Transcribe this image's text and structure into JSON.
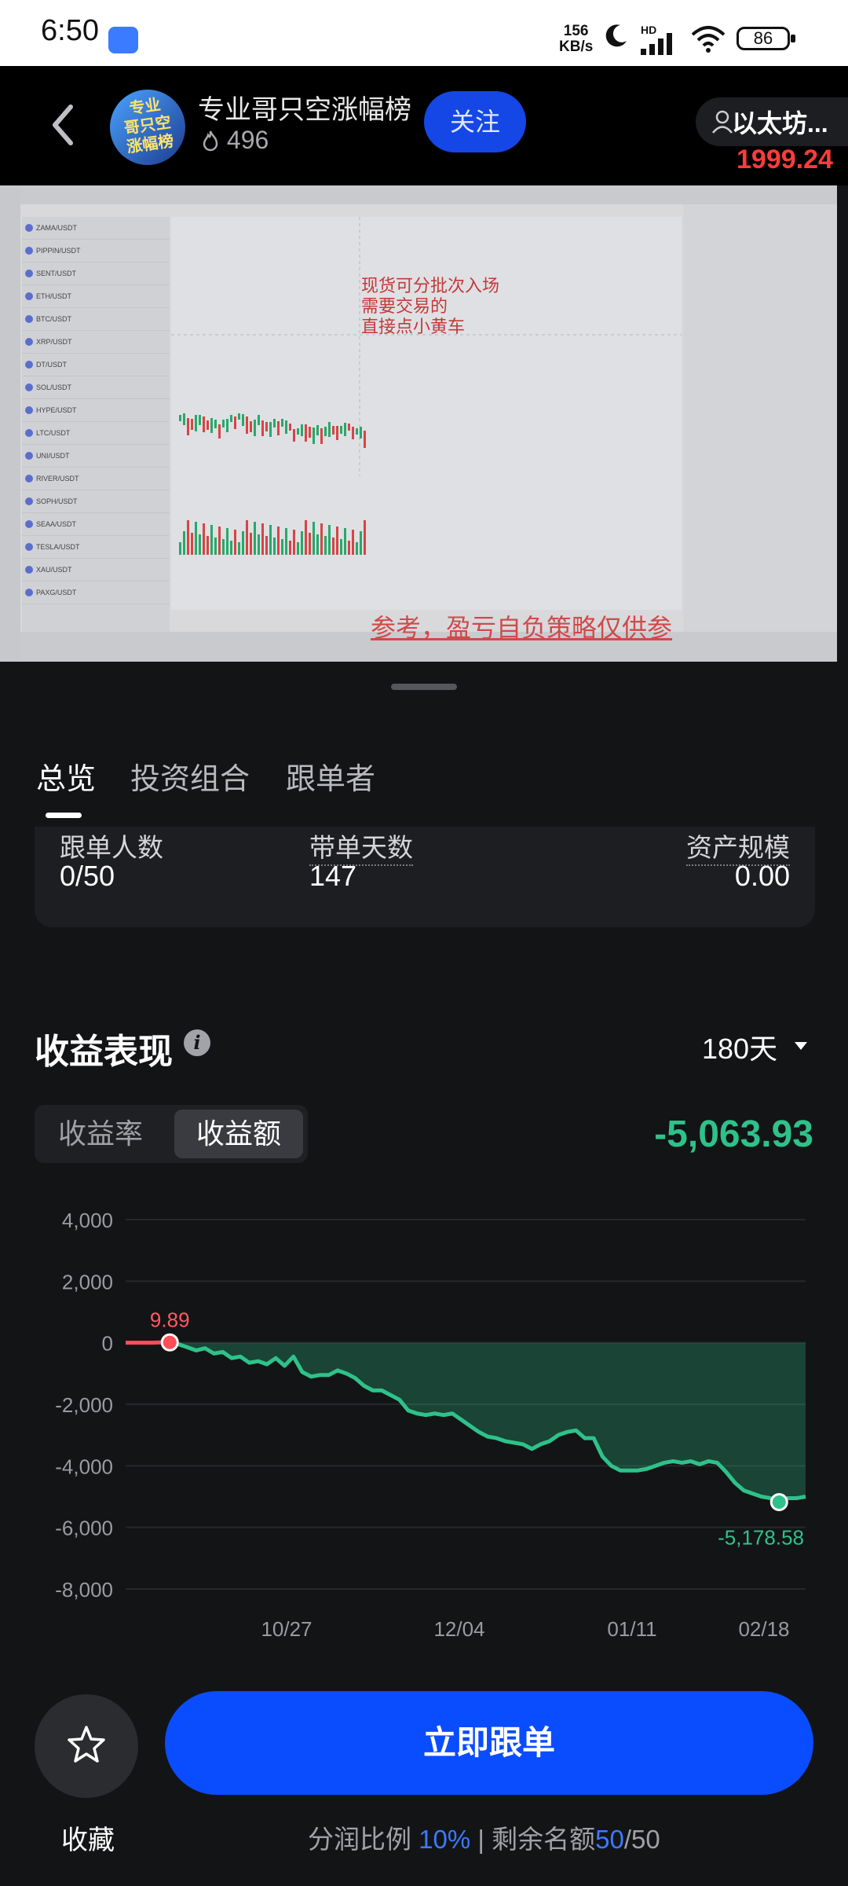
{
  "status_bar": {
    "time": "6:50",
    "net_speed_value": "156",
    "net_speed_unit": "KB/s",
    "network": "HD",
    "battery": "86"
  },
  "header": {
    "avatar_text": "专业\n哥只空\n涨幅榜",
    "trader_name": "专业哥只空涨幅榜",
    "hot_count": "496",
    "follow_label": "关注",
    "coin_name": "以太坊...",
    "coin_price": "1999.24"
  },
  "video": {
    "note": "现货可分批次入场\n需要交易的\n直接点小黄车",
    "watermark": "参考，盈亏自负策略仅供参",
    "rows": [
      "ZAMA/USDT",
      "PIPPIN/USDT",
      "SENT/USDT",
      "ETH/USDT",
      "BTC/USDT",
      "XRP/USDT",
      "DT/USDT",
      "SOL/USDT",
      "HYPE/USDT",
      "LTC/USDT",
      "UNI/USDT",
      "RIVER/USDT",
      "SOPH/USDT",
      "SEAA/USDT",
      "TESLA/USDT",
      "XAU/USDT",
      "PAXG/USDT"
    ]
  },
  "tabs": {
    "overview": "总览",
    "portfolio": "投资组合",
    "followers": "跟单者"
  },
  "stats": [
    {
      "label": "跟单人数",
      "value": "0/50"
    },
    {
      "label": "带单天数",
      "value": "147"
    },
    {
      "label": "资产规模",
      "value": "0.00"
    }
  ],
  "performance": {
    "title": "收益表现",
    "info_icon": "i",
    "period": "180天",
    "seg_rate": "收益率",
    "seg_amount": "收益额",
    "total": "-5,063.93"
  },
  "colors": {
    "up_green": "#2ec28a",
    "down_red": "#ff3b3b",
    "accent_blue": "#0a4cff"
  },
  "chart_data": {
    "type": "area",
    "x_ticks": [
      "10/27",
      "12/04",
      "01/11",
      "02/18"
    ],
    "y_ticks": [
      "4,000",
      "2,000",
      "0",
      "-2,000",
      "-4,000",
      "-6,000",
      "-8,000"
    ],
    "ylim": [
      -8000,
      4000
    ],
    "annotations": {
      "high": "9.89",
      "low": "-5,178.58"
    },
    "values": [
      0,
      0,
      0,
      0,
      10,
      9.89,
      -50,
      -150,
      -250,
      -180,
      -350,
      -300,
      -500,
      -450,
      -650,
      -600,
      -700,
      -500,
      -750,
      -450,
      -950,
      -1100,
      -1050,
      -1050,
      -900,
      -1000,
      -1150,
      -1400,
      -1550,
      -1550,
      -1700,
      -1850,
      -2200,
      -2300,
      -2350,
      -2300,
      -2350,
      -2300,
      -2500,
      -2700,
      -2900,
      -3050,
      -3100,
      -3200,
      -3250,
      -3300,
      -3450,
      -3300,
      -3200,
      -3000,
      -2900,
      -2850,
      -3100,
      -3100,
      -3700,
      -4000,
      -4150,
      -4150,
      -4150,
      -4100,
      -4000,
      -3900,
      -3850,
      -3900,
      -3850,
      -3950,
      -3850,
      -3900,
      -4200,
      -4550,
      -4800,
      -4900,
      -5000,
      -5050,
      -5178.58,
      -5050,
      -5050,
      -5000
    ]
  },
  "bottom": {
    "fav_label": "收藏",
    "cta_label": "立即跟单",
    "profit_label": "分润比例",
    "profit_value": "10%",
    "divider": "|",
    "quota_label": "剩余名额",
    "quota_used": "50",
    "quota_total": "/50"
  }
}
